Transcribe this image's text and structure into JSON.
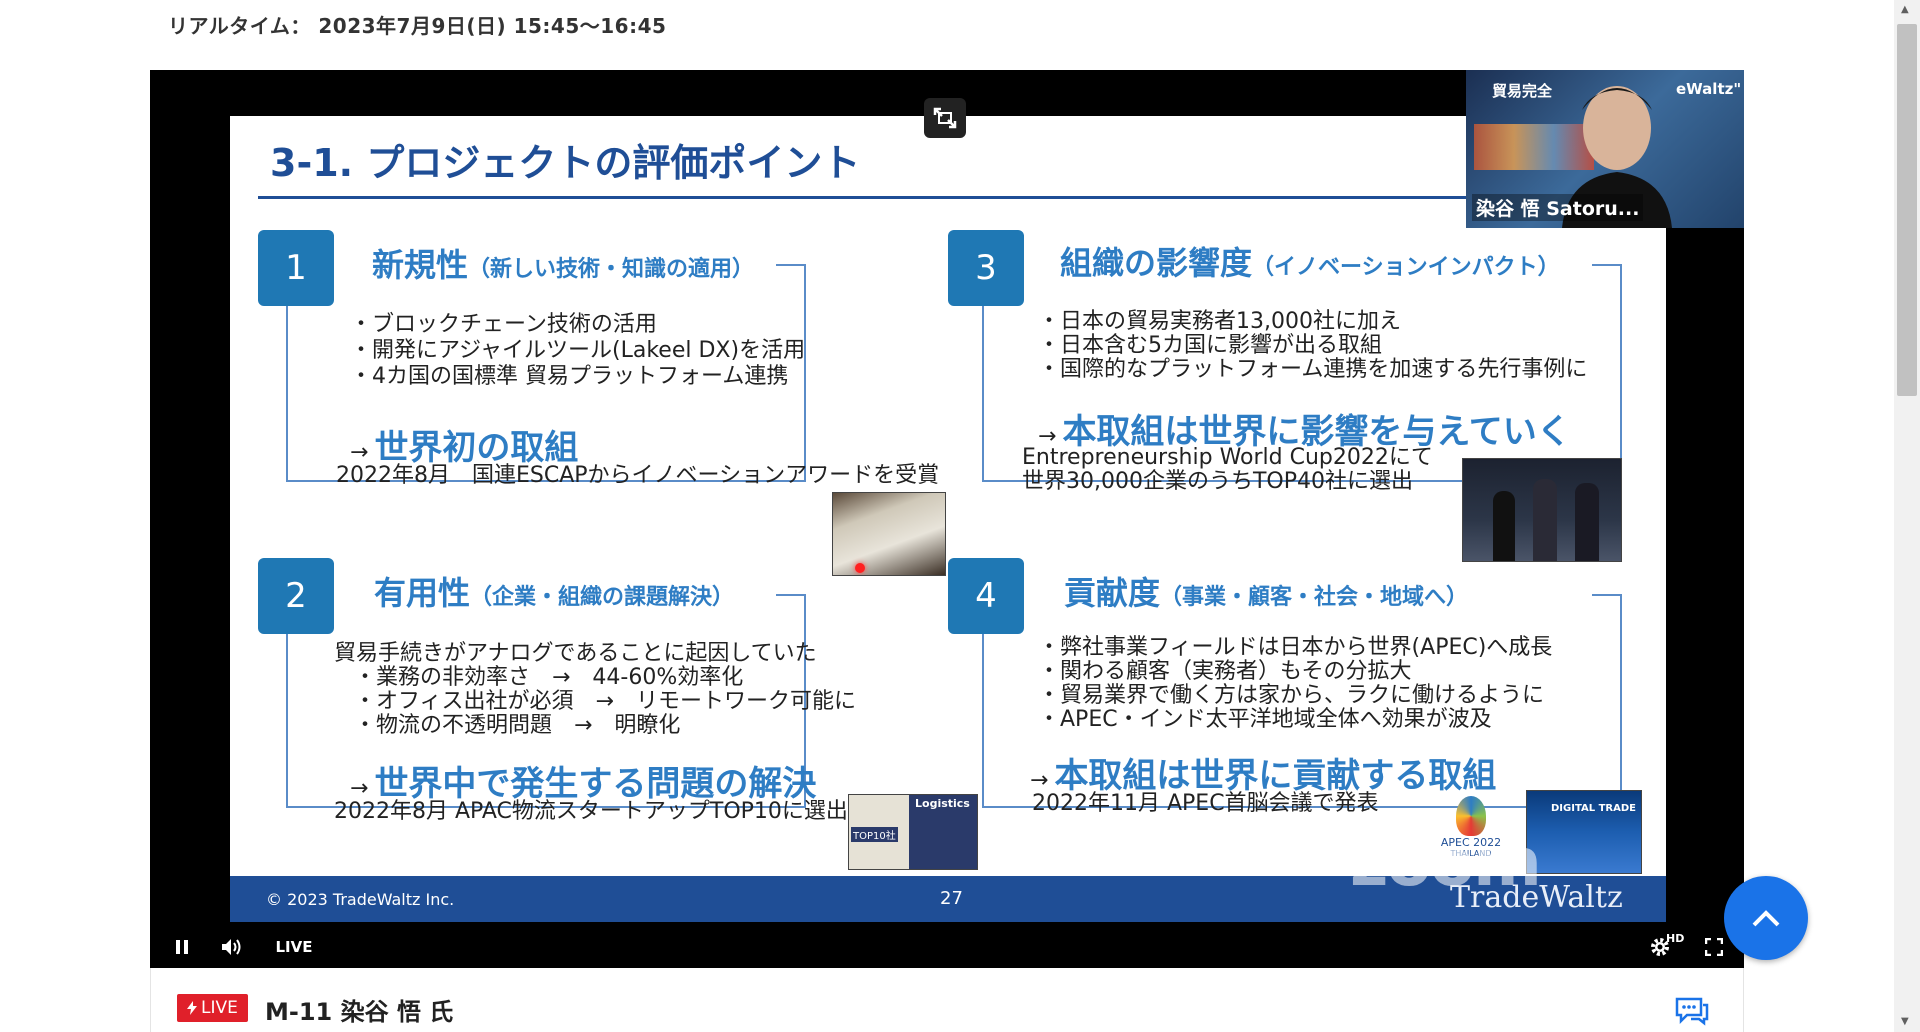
{
  "header": {
    "realtime": "リアルタイム： 2023年7月9日(日)  15:45〜16:45"
  },
  "slide": {
    "title": "3-1. プロジェクトの評価ポイント",
    "quadrants": [
      {
        "number": "1",
        "heading": "新規性",
        "subheading": "（新しい技術・知識の適用）",
        "bullets": [
          "・ブロックチェーン技術の活用",
          "・開発にアジャイルツール(Lakeel DX)を活用",
          "・4カ国の国標準 貿易プラットフォーム連携"
        ],
        "arrow": "→",
        "emphasis": "世界初の取組",
        "note": "2022年8月　国連ESCAPからイノベーションアワードを受賞"
      },
      {
        "number": "2",
        "heading": "有用性",
        "subheading": "（企業・組織の課題解決）",
        "lead": "貿易手続きがアナログであることに起因していた",
        "bullets": [
          "・業務の非効率さ　→　44-60%効率化",
          "・オフィス出社が必須　→　リモートワーク可能に",
          "・物流の不透明問題　→　明瞭化"
        ],
        "arrow": "→",
        "emphasis": "世界中で発生する問題の解決",
        "note": "2022年8月 APAC物流スタートアップTOP10に選出"
      },
      {
        "number": "3",
        "heading": "組織の影響度",
        "subheading": "（イノベーションインパクト）",
        "bullets": [
          "・日本の貿易実務者13,000社に加え",
          "・日本含む5カ国に影響が出る取組",
          "・国際的なプラットフォーム連携を加速する先行事例に"
        ],
        "arrow": "→",
        "emphasis": "本取組は世界に影響を与えていく",
        "note_lines": [
          "Entrepreneurship World Cup2022にて",
          "世界30,000企業のうちTOP40社に選出"
        ]
      },
      {
        "number": "4",
        "heading": "貢献度",
        "subheading": "（事業・顧客・社会・地域へ）",
        "bullets": [
          "・弊社事業フィールドは日本から世界(APEC)へ成長",
          "・関わる顧客（実務者）もその分拡大",
          "・貿易業界で働く方は家から、ラクに働けるように",
          "・APEC・インド太平洋地域全体へ効果が波及"
        ],
        "arrow": "→",
        "emphasis": "本取組は世界に貢献する取組",
        "note": "2022年11月 APEC首脳会議で発表"
      }
    ],
    "photo_labels": {
      "logistics": "Logistics",
      "top10": "TOP10社",
      "apec": "APEC 2022",
      "apec_sub": "THAILAND",
      "digital_trade": "DIGITAL TRADE"
    },
    "footer": {
      "copyright": "© 2023 TradeWaltz Inc.",
      "page": "27",
      "watermark": "TradeWaltz"
    }
  },
  "overlay": {
    "zoom_watermark": "zoom"
  },
  "pip": {
    "top_left": "貿易完全",
    "top_right": "eWaltz\"",
    "name": "染谷 悟 Satoru..."
  },
  "controls": {
    "live_label": "LIVE",
    "hd_label": "HD"
  },
  "session": {
    "live_badge": "LIVE",
    "title": "M-11 染谷 悟 氏"
  },
  "colors": {
    "slide_blue": "#1f4e96",
    "accent_blue": "#2e7dc4",
    "live_red": "#e0202a",
    "fab_blue": "#1a73e8"
  }
}
